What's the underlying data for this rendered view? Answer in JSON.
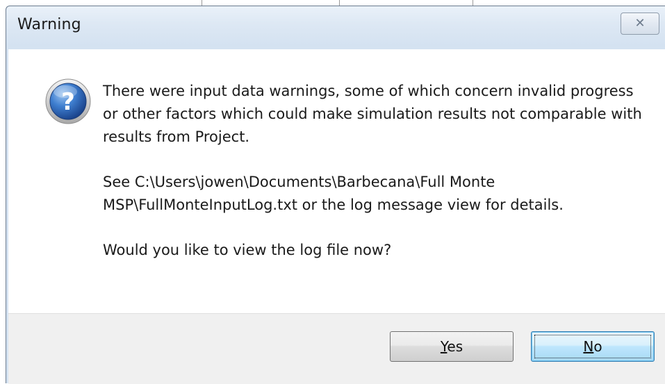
{
  "window": {
    "title": "Warning",
    "close_glyph": "✕"
  },
  "icon": "question-icon",
  "message": {
    "line1": "There were input data warnings, some of which concern invalid progress or other factors which could make simulation results not comparable with results from Project.",
    "line2": "See C:\\Users\\jowen\\Documents\\Barbecana\\Full Monte MSP\\FullMonteInputLog.txt or the log message view for details.",
    "line3": "Would you like to view the log file now?"
  },
  "buttons": {
    "yes_mnemonic": "Y",
    "yes_rest": "es",
    "no_mnemonic": "N",
    "no_rest": "o"
  },
  "colors": {
    "titlebar": "#d4e2f1",
    "button_area": "#f0f0f0",
    "default_button_border": "#3c7fb1"
  }
}
